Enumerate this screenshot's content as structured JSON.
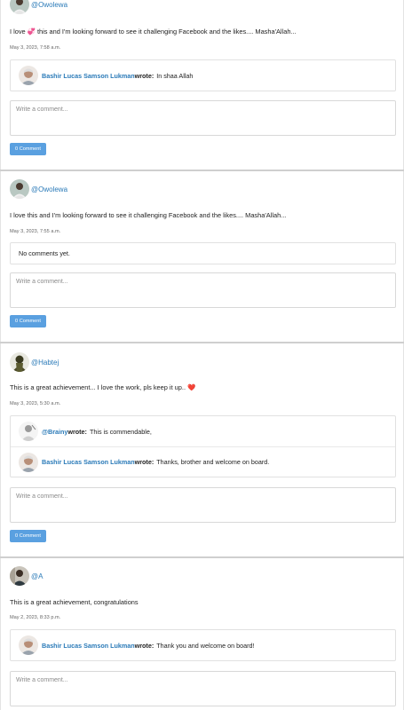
{
  "posts": [
    {
      "handle": "@Owolewa",
      "text": "I love 💞 this and I'm looking forward to see it challenging Facebook and the likes.... Masha'Allah...",
      "time": "May 3, 2023, 7:58 a.m.",
      "comments": [
        {
          "author": "Bashir Lucas Samson Lukman",
          "wrote": "wrote:",
          "text": "In shaa Allah"
        }
      ],
      "input_placeholder": "Write a comment...",
      "button_label": "Comment"
    },
    {
      "handle": "@Owolewa",
      "text": "I love this and I'm looking forward to see it challenging Facebook and the likes.... Masha'Allah...",
      "time": "May 3, 2023, 7:55 a.m.",
      "empty_text": "No comments yet.",
      "input_placeholder": "Write a comment...",
      "button_label": "Comment"
    },
    {
      "handle": "@Habtej",
      "text": "This is a great achievement... I love the work, pls keep it up.. ❤️",
      "time": "May 3, 2023, 5:30 a.m.",
      "comments": [
        {
          "author": "@Brainy",
          "wrote": "wrote:",
          "text": "This is commendable,"
        },
        {
          "author": "Bashir Lucas Samson Lukman",
          "wrote": "wrote:",
          "text": "Thanks, brother and welcome on board."
        }
      ],
      "input_placeholder": "Write a comment...",
      "button_label": "Comment"
    },
    {
      "handle": "@A",
      "text": "This is a great achievement, congratulations",
      "time": "May 2, 2023, 8:33 p.m.",
      "comments": [
        {
          "author": "Bashir Lucas Samson Lukman",
          "wrote": "wrote:",
          "text": "Thank you and welcome on board!"
        }
      ],
      "input_placeholder": "Write a comment..."
    }
  ],
  "colors": {
    "link": "#2a7ab8",
    "button": "#5aa0e0",
    "divider": "#cfcfcf"
  }
}
